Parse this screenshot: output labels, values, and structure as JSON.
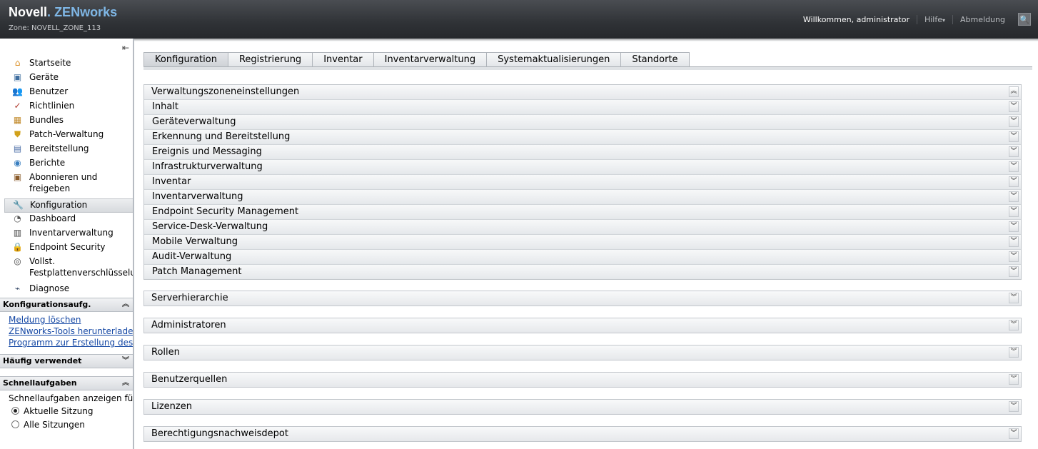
{
  "header": {
    "brand_novell": "Novell",
    "brand_dot": ".",
    "brand_product": "ZENworks",
    "zone": "Zone: NOVELL_ZONE_113",
    "welcome": "Willkommen, administrator",
    "help": "Hilfe",
    "help_caret": "▾",
    "logout": "Abmeldung",
    "search_icon": "🔍"
  },
  "sidebar": {
    "collapse_icon": "⇤",
    "nav": [
      {
        "label": "Startseite",
        "icon": "home-icon",
        "glyph": "⌂",
        "color": "#d98a1b"
      },
      {
        "label": "Geräte",
        "icon": "monitor-icon",
        "glyph": "▣",
        "color": "#3f6e9f"
      },
      {
        "label": "Benutzer",
        "icon": "users-icon",
        "glyph": "👥",
        "color": "#4a7d3c"
      },
      {
        "label": "Richtlinien",
        "icon": "policy-icon",
        "glyph": "✓",
        "color": "#b03a2e"
      },
      {
        "label": "Bundles",
        "icon": "bundle-icon",
        "glyph": "▦",
        "color": "#c28a2b"
      },
      {
        "label": "Patch-Verwaltung",
        "icon": "shield-icon",
        "glyph": "⛊",
        "color": "#d1a11a"
      },
      {
        "label": "Bereitstellung",
        "icon": "deployment-icon",
        "glyph": "▤",
        "color": "#4d6fa8"
      },
      {
        "label": "Berichte",
        "icon": "report-icon",
        "glyph": "◉",
        "color": "#3a7fc0"
      },
      {
        "label": "Abonnieren und freigeben",
        "icon": "subscribe-icon",
        "glyph": "▣",
        "color": "#8a5b2b"
      },
      {
        "label": "Konfiguration",
        "icon": "wrench-icon",
        "glyph": "🔧",
        "color": "#6b7b5b"
      },
      {
        "label": "Dashboard",
        "icon": "gauge-icon",
        "glyph": "◔",
        "color": "#555"
      },
      {
        "label": "Inventarverwaltung",
        "icon": "inventory-icon",
        "glyph": "▥",
        "color": "#444"
      },
      {
        "label": "Endpoint Security",
        "icon": "lock-icon",
        "glyph": "🔒",
        "color": "#555"
      },
      {
        "label": "Vollst. Festplattenverschlüsselung",
        "icon": "disk-icon",
        "glyph": "◎",
        "color": "#444"
      },
      {
        "label": "Diagnose",
        "icon": "diagnose-icon",
        "glyph": "⌁",
        "color": "#2a3f5f"
      }
    ],
    "config_tasks": {
      "title": "Konfigurationsaufg.",
      "links": [
        "Meldung löschen",
        "ZENworks-Tools herunterladen",
        "Programm zur Erstellung des PXE-Images"
      ]
    },
    "frequent": {
      "title": "Häufig verwendet"
    },
    "quick_tasks": {
      "title": "Schnellaufgaben",
      "prompt": "Schnellaufgaben anzeigen für:",
      "options": [
        "Aktuelle Sitzung",
        "Alle Sitzungen"
      ],
      "selected": "Aktuelle Sitzung"
    }
  },
  "tabs": [
    "Konfiguration",
    "Registrierung",
    "Inventar",
    "Inventarverwaltung",
    "Systemaktualisierungen",
    "Standorte"
  ],
  "active_tab": "Konfiguration",
  "zone_settings": {
    "title": "Verwaltungszoneneinstellungen",
    "rows": [
      "Inhalt",
      "Geräteverwaltung",
      "Erkennung und Bereitstellung",
      "Ereignis und Messaging",
      "Infrastrukturverwaltung",
      "Inventar",
      "Inventarverwaltung",
      "Endpoint Security Management",
      "Service-Desk-Verwaltung",
      "Mobile Verwaltung",
      "Audit-Verwaltung",
      "Patch Management"
    ]
  },
  "collapsed_sections": [
    "Serverhierarchie",
    "Administratoren",
    "Rollen",
    "Benutzerquellen",
    "Lizenzen",
    "Berechtigungsnachweisdepot"
  ],
  "glyphs": {
    "expand": "︾",
    "collapse": "︽"
  }
}
